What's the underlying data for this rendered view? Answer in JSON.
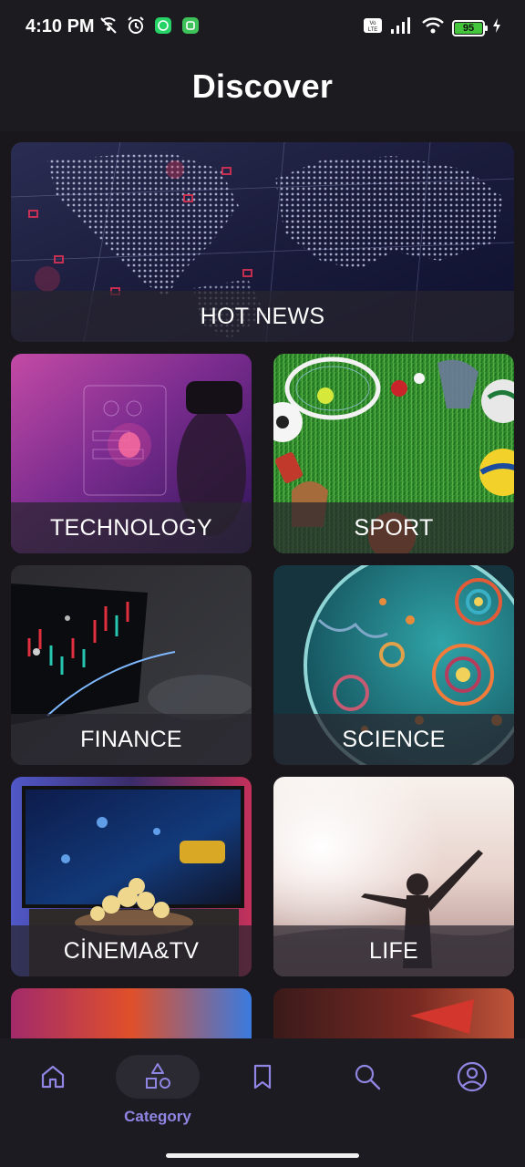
{
  "status_bar": {
    "time": "4:10 PM",
    "battery": "95",
    "left_icons": [
      "wifi-call-muted-icon",
      "alarm-icon",
      "whatsapp-icon",
      "app-notification-icon"
    ],
    "right_icons": [
      "volte-icon",
      "signal-icon",
      "wifi-icon",
      "battery-icon",
      "charging-icon"
    ]
  },
  "header": {
    "title": "Discover"
  },
  "categories": [
    {
      "label": "HOT NEWS"
    },
    {
      "label": "TECHNOLOGY"
    },
    {
      "label": "SPORT"
    },
    {
      "label": "FINANCE"
    },
    {
      "label": "SCIENCE"
    },
    {
      "label": "CİNEMA&TV"
    },
    {
      "label": "LIFE"
    }
  ],
  "bottom_nav": {
    "items": [
      {
        "icon": "home-icon"
      },
      {
        "icon": "category-icon",
        "label": "Category",
        "active": true
      },
      {
        "icon": "bookmark-icon"
      },
      {
        "icon": "search-icon"
      },
      {
        "icon": "profile-icon"
      }
    ]
  },
  "colors": {
    "background": "#1a181d",
    "accent": "#8f85e3",
    "card_label_bar": "#28262e"
  }
}
